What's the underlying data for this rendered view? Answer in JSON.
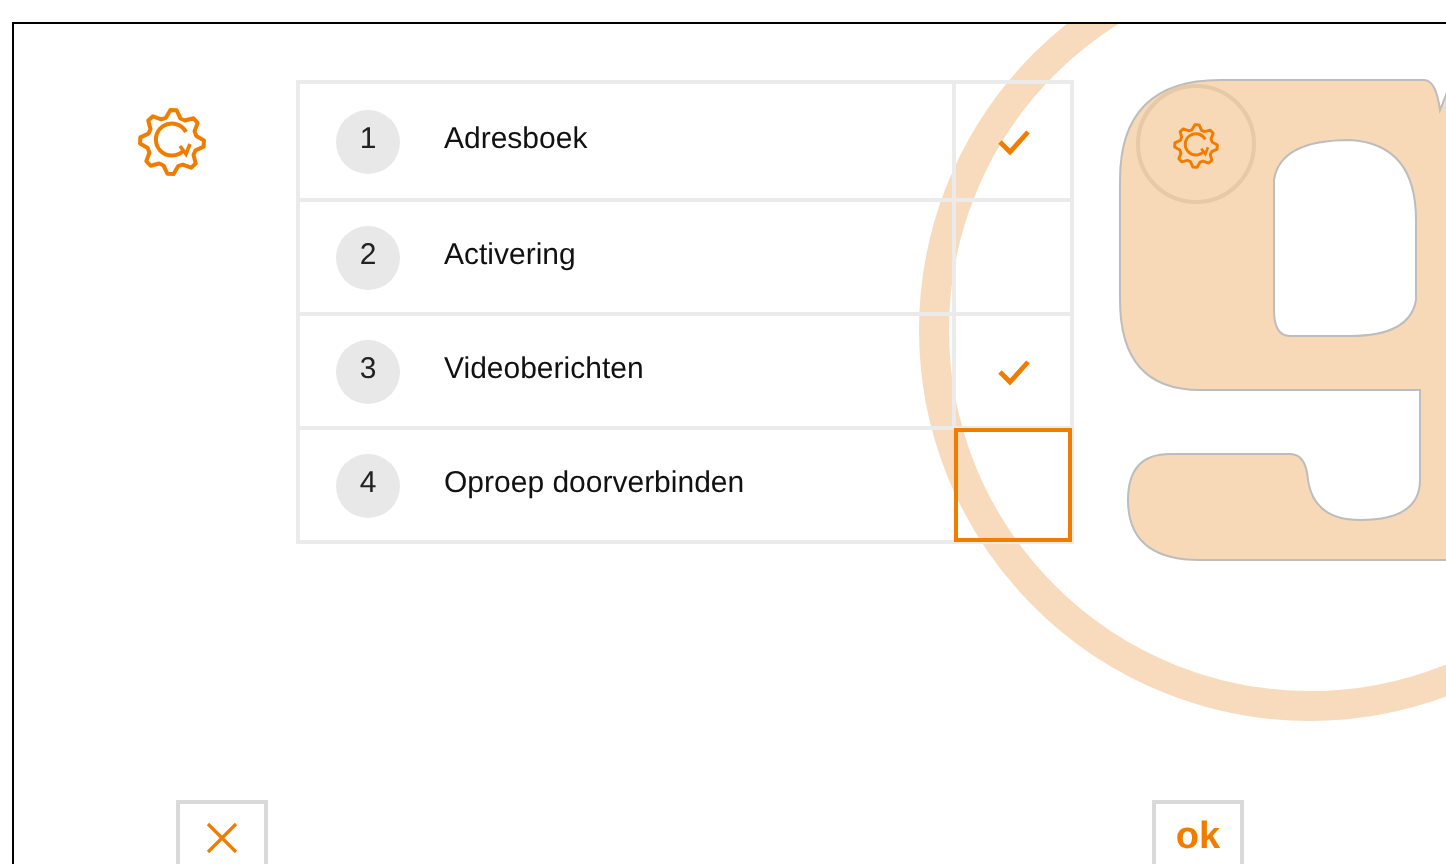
{
  "rows": [
    {
      "number": "1",
      "label": "Adresboek",
      "checked": true,
      "selected": false
    },
    {
      "number": "2",
      "label": "Activering",
      "checked": false,
      "selected": false
    },
    {
      "number": "3",
      "label": "Videoberichten",
      "checked": true,
      "selected": false
    },
    {
      "number": "4",
      "label": "Oproep doorverbinden",
      "checked": false,
      "selected": true
    }
  ],
  "buttons": [
    {
      "kind": "cancel"
    },
    {
      "kind": "ok",
      "label": "ok"
    }
  ]
}
